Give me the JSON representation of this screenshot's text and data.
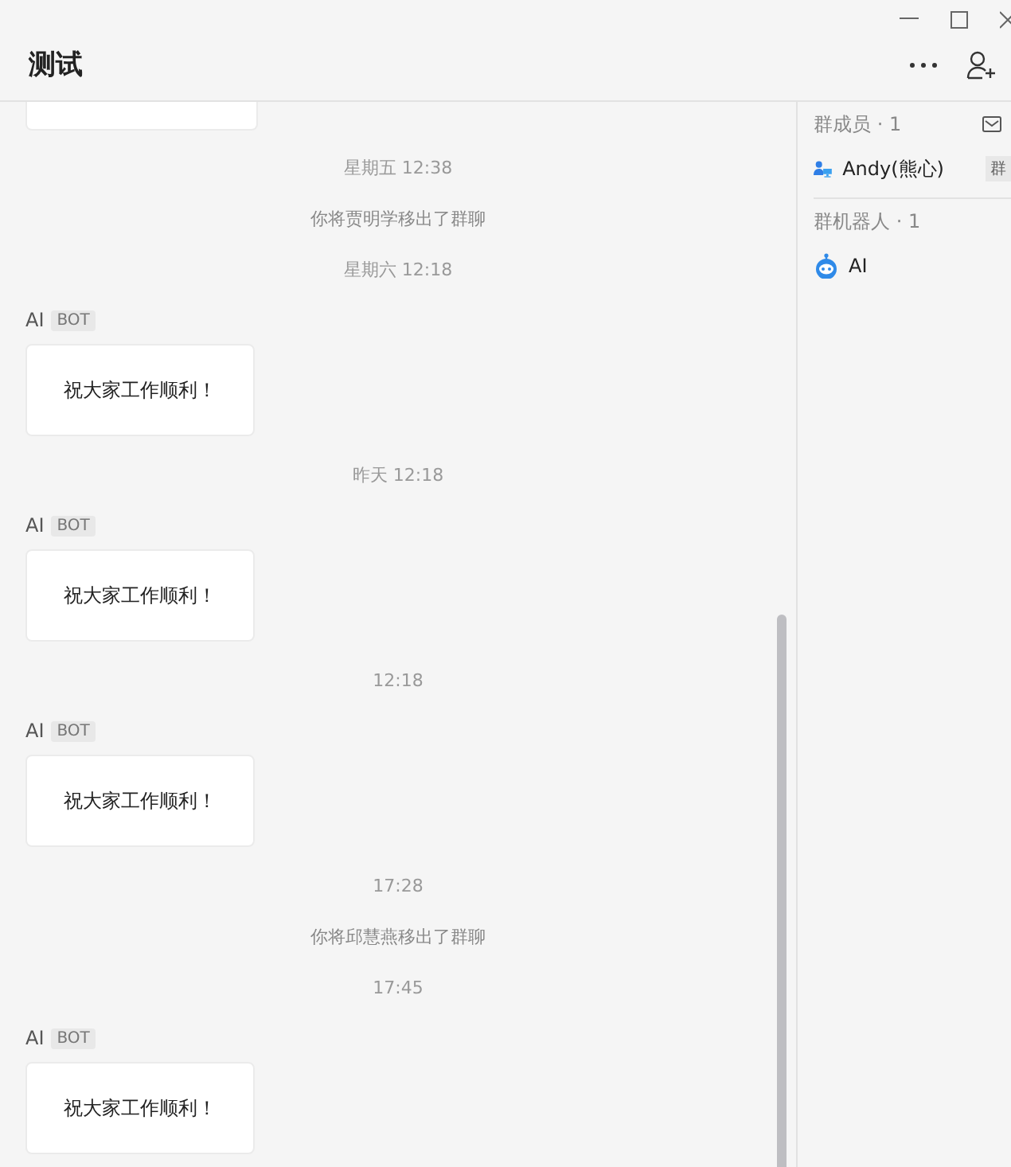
{
  "window": {
    "title": "测试"
  },
  "messages": [
    {
      "kind": "partial"
    },
    {
      "kind": "time",
      "text": "星期五 12:38"
    },
    {
      "kind": "system",
      "text": "你将贾明学移出了群聊"
    },
    {
      "kind": "time",
      "text": "星期六 12:18"
    },
    {
      "kind": "message",
      "sender": "AI",
      "badge": "BOT",
      "text": "祝大家工作顺利！"
    },
    {
      "kind": "time",
      "text": "昨天 12:18"
    },
    {
      "kind": "message",
      "sender": "AI",
      "badge": "BOT",
      "text": "祝大家工作顺利！"
    },
    {
      "kind": "time",
      "text": "12:18"
    },
    {
      "kind": "message",
      "sender": "AI",
      "badge": "BOT",
      "text": "祝大家工作顺利！"
    },
    {
      "kind": "time",
      "text": "17:28"
    },
    {
      "kind": "system",
      "text": "你将邱慧燕移出了群聊"
    },
    {
      "kind": "time",
      "text": "17:45"
    },
    {
      "kind": "message",
      "sender": "AI",
      "badge": "BOT",
      "text": "祝大家工作顺利！"
    }
  ],
  "sidebar": {
    "sections": [
      {
        "title": "群成员 · 1",
        "kind": "members",
        "items": [
          {
            "name": "Andy(熊心)",
            "tag": "群"
          }
        ]
      },
      {
        "title": "群机器人 · 1",
        "kind": "bots",
        "items": [
          {
            "name": "AI"
          }
        ]
      }
    ]
  }
}
